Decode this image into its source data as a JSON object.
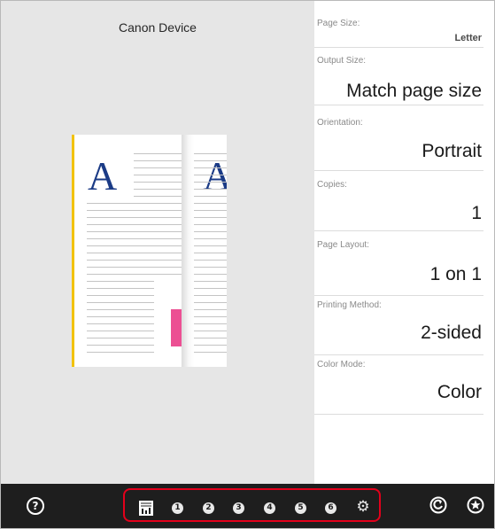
{
  "preview": {
    "device_name": "Canon Device",
    "page_letter": "A"
  },
  "settings": [
    {
      "label": "Page Size:",
      "value": "Letter"
    },
    {
      "label": "Output Size:",
      "value": "Match page size"
    },
    {
      "label": "Orientation:",
      "value": "Portrait"
    },
    {
      "label": "Copies:",
      "value": "1"
    },
    {
      "label": "Page Layout:",
      "value": "1 on 1"
    },
    {
      "label": "Printing Method:",
      "value": "2-sided"
    },
    {
      "label": "Color Mode:",
      "value": "Color"
    }
  ],
  "bottombar": {
    "help_icon": "?",
    "tabs": [
      "1",
      "2",
      "3",
      "4",
      "5",
      "6"
    ],
    "summary_icon": "summary-icon",
    "gear_icon": "gear-icon",
    "reset_icon": "reset-icon",
    "favorite_icon": "star-icon"
  }
}
